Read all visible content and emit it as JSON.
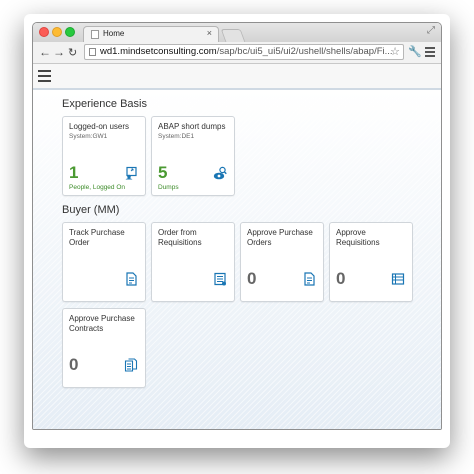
{
  "browser": {
    "tab_title": "Home",
    "tab_close": "×",
    "url_host": "wd1.mindsetconsulting.com",
    "url_path": "/sap/bc/ui5_ui5/ui2/ushell/shells/abap/Fi..."
  },
  "groups": [
    {
      "title": "Experience Basis",
      "tiles": [
        {
          "title": "Logged-on users",
          "subtitle": "System:GW1",
          "number": "1",
          "footer": "People, Logged On",
          "icon": "users-monitor-icon"
        },
        {
          "title": "ABAP short dumps",
          "subtitle": "System:DE1",
          "number": "5",
          "footer": "Dumps",
          "icon": "dump-search-icon"
        }
      ]
    },
    {
      "title": "Buyer (MM)",
      "tiles": [
        {
          "title": "Track Purchase Order",
          "number": "",
          "icon": "document-icon"
        },
        {
          "title": "Order from Requisitions",
          "number": "",
          "icon": "document-list-icon"
        },
        {
          "title": "Approve Purchase Orders",
          "number": "0",
          "icon": "document-icon"
        },
        {
          "title": "Approve Requisitions",
          "number": "0",
          "icon": "list-icon"
        },
        {
          "title": "Approve Purchase Contracts",
          "number": "0",
          "icon": "documents-icon"
        }
      ]
    }
  ],
  "colors": {
    "accent": "#1a76b4",
    "kpi_green": "#4b9a32"
  }
}
